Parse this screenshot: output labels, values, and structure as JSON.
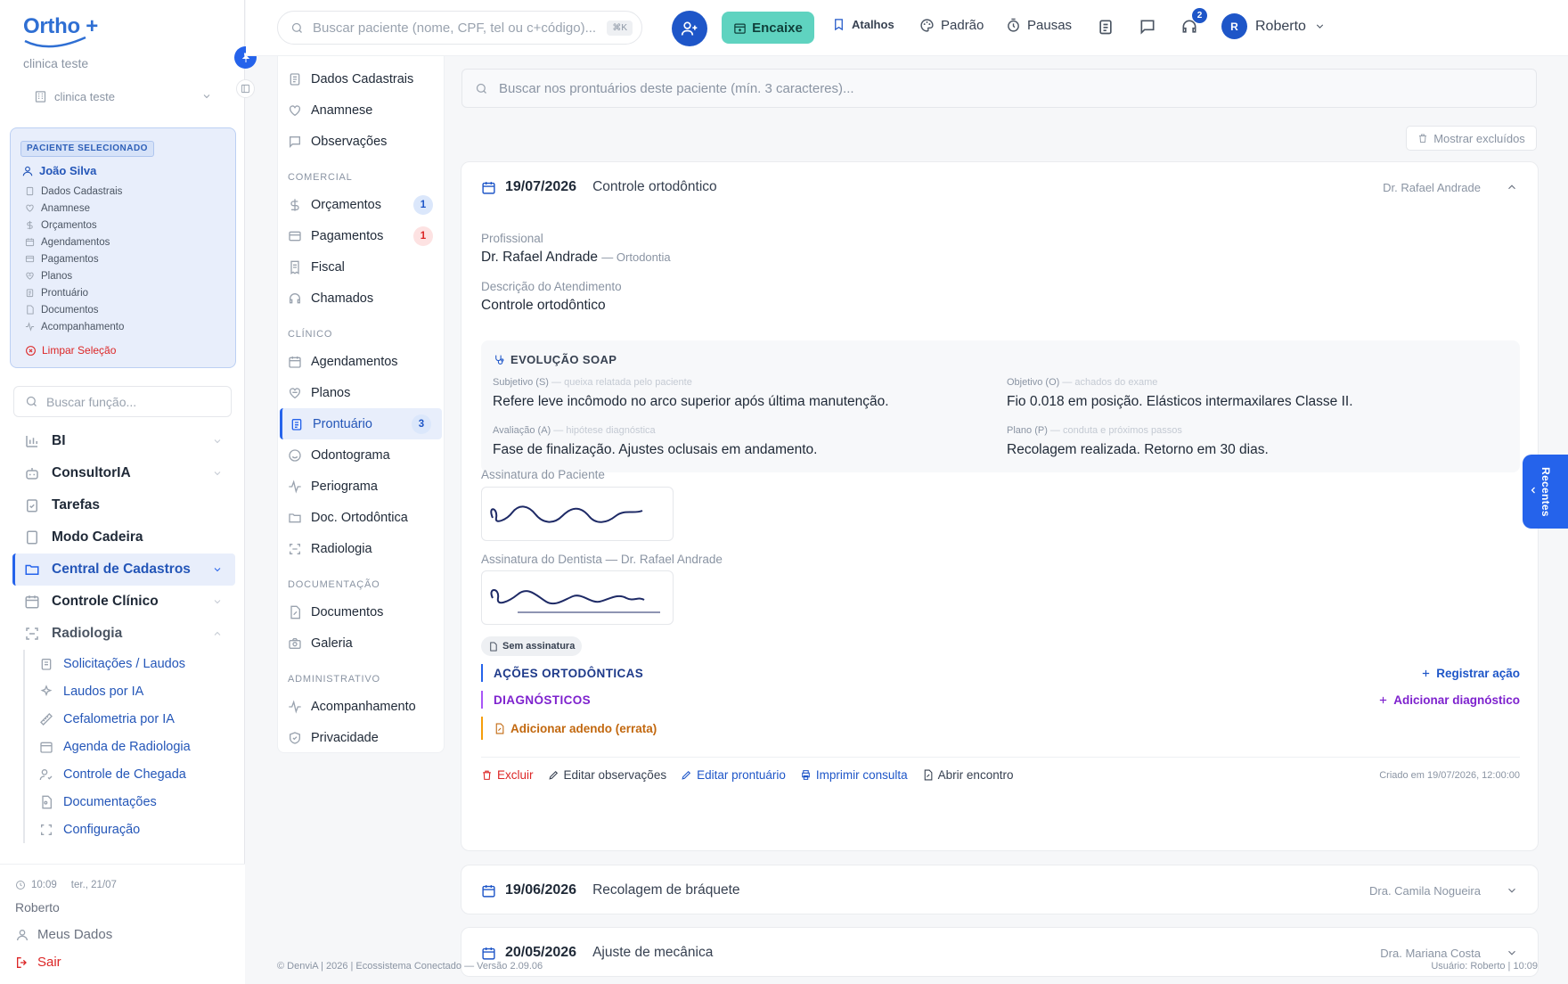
{
  "brand": {
    "logo": "Ortho +",
    "clinic_label": "clinica teste",
    "clinic_select": "clinica teste"
  },
  "patient": {
    "badge": "PACIENTE SELECIONADO",
    "name": "João Silva",
    "links": [
      {
        "label": "Dados Cadastrais",
        "icon": "doc-icon"
      },
      {
        "label": "Anamnese",
        "icon": "heart-icon"
      },
      {
        "label": "Orçamentos",
        "icon": "dollar-icon"
      },
      {
        "label": "Agendamentos",
        "icon": "calendar-icon"
      },
      {
        "label": "Pagamentos",
        "icon": "card-icon"
      },
      {
        "label": "Planos",
        "icon": "plan-icon"
      },
      {
        "label": "Prontuário",
        "icon": "clipboard-icon"
      },
      {
        "label": "Documentos",
        "icon": "file-icon"
      },
      {
        "label": "Acompanhamento",
        "icon": "pulse-icon"
      }
    ],
    "clear": "Limpar Seleção"
  },
  "function_search": {
    "placeholder": "Buscar função..."
  },
  "menu": {
    "bi": "BI",
    "consultoria": "ConsultorIA",
    "tarefas": "Tarefas",
    "modo_cadeira": "Modo Cadeira",
    "central": "Central de Cadastros",
    "controle": "Controle Clínico",
    "radiologia": "Radiologia",
    "radiologia_sub": [
      "Solicitações / Laudos",
      "Laudos por IA",
      "Cefalometria por IA",
      "Agenda de Radiologia",
      "Controle de Chegada",
      "Documentações",
      "Configuração"
    ]
  },
  "sidebar_footer": {
    "time": "10:09",
    "date": "ter., 21/07",
    "user": "Roberto",
    "my_data": "Meus Dados",
    "logout": "Sair"
  },
  "topbar": {
    "search_placeholder": "Buscar paciente (nome, CPF, tel ou c+código)...",
    "kbd": "⌘K",
    "encaixe": "Encaixe",
    "atalhos": "Atalhos",
    "padrao": "Padrão",
    "pausas": "Pausas",
    "support_badge": "2",
    "user": "Roberto",
    "avatar": "R"
  },
  "subnav": {
    "top": [
      "Dados Cadastrais",
      "Anamnese",
      "Observações"
    ],
    "comercial_title": "COMERCIAL",
    "orcamentos": "Orçamentos",
    "orcamentos_count": "1",
    "pagamentos": "Pagamentos",
    "pagamentos_count": "1",
    "fiscal": "Fiscal",
    "chamados": "Chamados",
    "clinico_title": "CLÍNICO",
    "agendamentos": "Agendamentos",
    "planos": "Planos",
    "prontuario": "Prontuário",
    "prontuario_count": "3",
    "odontograma": "Odontograma",
    "periograma": "Periograma",
    "doc_ortodontica": "Doc. Ortodôntica",
    "radiologia": "Radiologia",
    "documentacao_title": "DOCUMENTAÇÃO",
    "documentos": "Documentos",
    "galeria": "Galeria",
    "administrativo_title": "ADMINISTRATIVO",
    "acompanhamento": "Acompanhamento",
    "privacidade": "Privacidade"
  },
  "records": {
    "search_placeholder": "Buscar nos prontuários deste paciente (mín. 3 caracteres)...",
    "show_excluded": "Mostrar excluídos"
  },
  "record1": {
    "date": "19/07/2026",
    "title": "Controle ortodôntico",
    "doctor": "Dr. Rafael Andrade",
    "prof_label": "Profissional",
    "prof_value": "Dr. Rafael Andrade",
    "prof_spec": "— Ortodontia",
    "desc_label": "Descrição do Atendimento",
    "desc_value": "Controle ortodôntico",
    "soap": {
      "title": "EVOLUÇÃO SOAP",
      "s_label": "Subjetivo (S)",
      "s_hint": "— queixa relatada pelo paciente",
      "s_value": "Refere leve incômodo no arco superior após última manutenção.",
      "o_label": "Objetivo (O)",
      "o_hint": "— achados do exame",
      "o_value": "Fio 0.018 em posição. Elásticos intermaxilares Classe II.",
      "a_label": "Avaliação (A)",
      "a_hint": "— hipótese diagnóstica",
      "a_value": "Fase de finalização. Ajustes oclusais em andamento.",
      "p_label": "Plano (P)",
      "p_hint": "— conduta e próximos passos",
      "p_value": "Recolagem realizada. Retorno em 30 dias."
    },
    "sig_patient": "Assinatura do Paciente",
    "sig_dentist": "Assinatura do Dentista — Dr. Rafael Andrade",
    "no_signature": "Sem assinatura",
    "acoes": "AÇÕES ORTODÔNTICAS",
    "registrar": "Registrar ação",
    "diagnosticos": "DIAGNÓSTICOS",
    "add_diag": "Adicionar diagnóstico",
    "adendo": "Adicionar adendo (errata)",
    "actions": {
      "excluir": "Excluir",
      "editar_obs": "Editar observações",
      "editar_pront": "Editar prontuário",
      "imprimir": "Imprimir consulta",
      "abrir": "Abrir encontro"
    },
    "created": "Criado em 19/07/2026, 12:00:00"
  },
  "record2": {
    "date": "19/06/2026",
    "title": "Recolagem de bráquete",
    "doctor": "Dra. Camila Nogueira"
  },
  "record3": {
    "date": "20/05/2026",
    "title": "Ajuste de mecânica",
    "doctor": "Dra. Mariana Costa"
  },
  "recentes": "Recentes",
  "footer": {
    "left": "© DenviA | 2026 | Ecossistema Conectado — Versão 2.09.06",
    "right": "Usuário: Roberto | 10:09"
  },
  "colors": {
    "primary": "#2563eb",
    "encaixe": "#5fd3c0",
    "danger": "#dc2626",
    "diagnostic": "#7e22ce",
    "addendum": "#c2680f"
  }
}
